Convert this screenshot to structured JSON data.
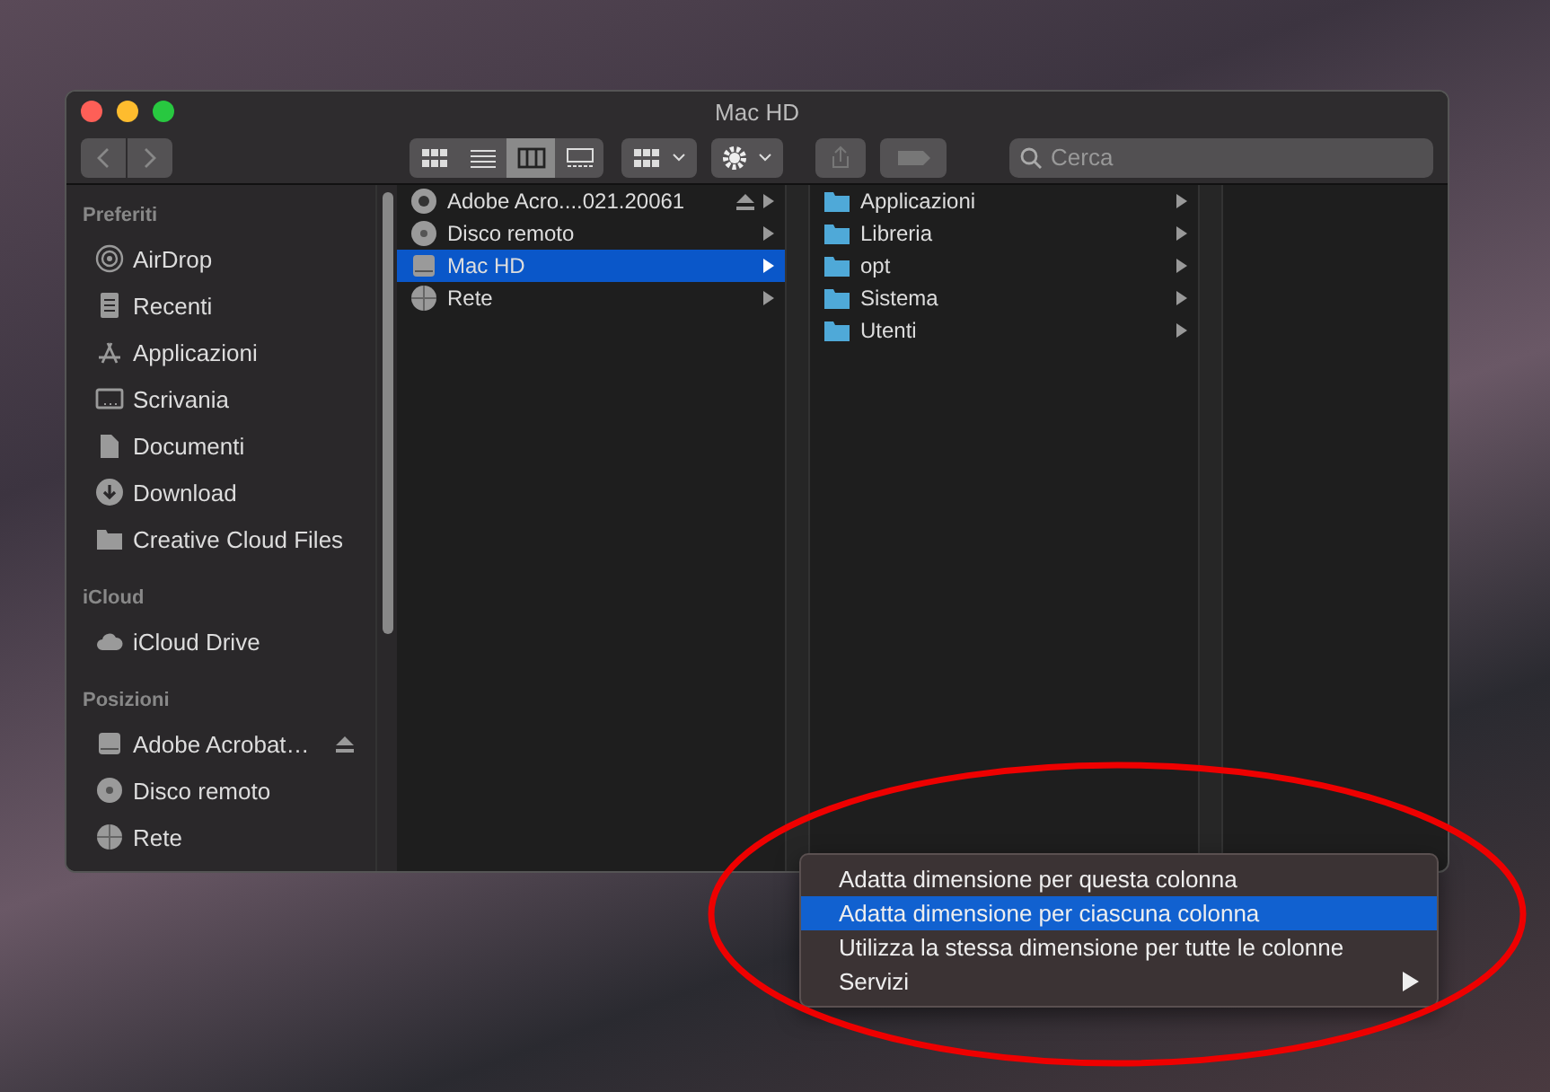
{
  "window": {
    "title": "Mac HD"
  },
  "toolbar": {
    "view_buttons": [
      {
        "kind": "icons",
        "selected": false
      },
      {
        "kind": "list",
        "selected": false
      },
      {
        "kind": "columns",
        "selected": true
      },
      {
        "kind": "gallery",
        "selected": false
      }
    ],
    "search": {
      "placeholder": "Cerca"
    }
  },
  "sidebar": {
    "sections": [
      {
        "title": "Preferiti",
        "items": [
          {
            "label": "AirDrop",
            "kind": "airdrop"
          },
          {
            "label": "Recenti",
            "kind": "recent"
          },
          {
            "label": "Applicazioni",
            "kind": "apps"
          },
          {
            "label": "Scrivania",
            "kind": "desktop"
          },
          {
            "label": "Documenti",
            "kind": "docs"
          },
          {
            "label": "Download",
            "kind": "download"
          },
          {
            "label": "Creative Cloud Files",
            "kind": "folder"
          }
        ]
      },
      {
        "title": "iCloud",
        "items": [
          {
            "label": "iCloud Drive",
            "kind": "cloud"
          }
        ]
      },
      {
        "title": "Posizioni",
        "items": [
          {
            "label": "Adobe Acrobat…",
            "kind": "drive",
            "eject": true
          },
          {
            "label": "Disco remoto",
            "kind": "disc"
          },
          {
            "label": "Rete",
            "kind": "network"
          }
        ]
      }
    ]
  },
  "columns": [
    {
      "items": [
        {
          "label": "Adobe Acro....021.20061",
          "kind": "volume",
          "eject": true,
          "selected": false
        },
        {
          "label": "Disco remoto",
          "kind": "disc",
          "selected": false
        },
        {
          "label": "Mac HD",
          "kind": "drive",
          "selected": true
        },
        {
          "label": "Rete",
          "kind": "network",
          "selected": false
        }
      ]
    },
    {
      "items": [
        {
          "label": "Applicazioni",
          "kind": "folder",
          "selected": false
        },
        {
          "label": "Libreria",
          "kind": "folder",
          "selected": false
        },
        {
          "label": "opt",
          "kind": "folder",
          "selected": false
        },
        {
          "label": "Sistema",
          "kind": "folder",
          "selected": false
        },
        {
          "label": "Utenti",
          "kind": "folder",
          "selected": false
        }
      ]
    }
  ],
  "context_menu": {
    "items": [
      {
        "label": "Adatta dimensione per questa colonna",
        "selected": false,
        "submenu": false
      },
      {
        "label": "Adatta dimensione per ciascuna colonna",
        "selected": true,
        "submenu": false
      },
      {
        "label": "Utilizza la stessa dimensione per tutte le colonne",
        "selected": false,
        "submenu": false
      },
      {
        "label": "Servizi",
        "selected": false,
        "submenu": true
      }
    ]
  }
}
